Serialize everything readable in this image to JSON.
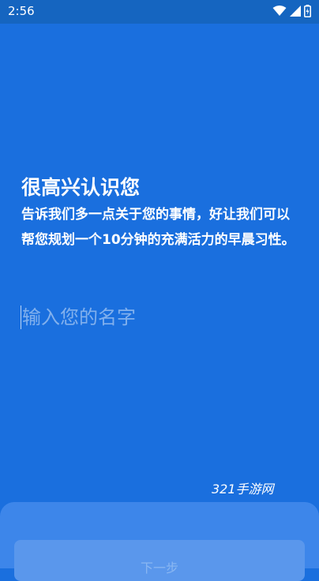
{
  "status_bar": {
    "time": "2:56",
    "icons": [
      "wifi-icon",
      "signal-icon",
      "battery-icon"
    ]
  },
  "greeting": {
    "title": "很高兴认识您",
    "text": "告诉我们多一点关于您的事情，好让我们可以帮您规划一个10分钟的充满活力的早晨习性。"
  },
  "name_input": {
    "placeholder": "输入您的名字",
    "value": ""
  },
  "watermark": "321手游网",
  "next_button": {
    "label": "下一步"
  },
  "colors": {
    "background": "#1a6fde",
    "status_bar": "#1565c0",
    "button": "#5a97ec"
  }
}
